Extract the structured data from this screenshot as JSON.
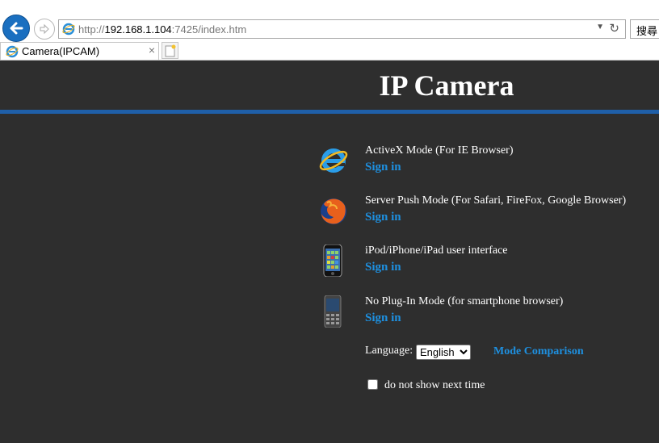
{
  "browser": {
    "url_prefix": "http://",
    "url_host": "192.168.1.104",
    "url_rest": ":7425/index.htm",
    "search_label": "搜尋",
    "tab_title": "Camera(IPCAM)",
    "tab_close": "×"
  },
  "page": {
    "title": "IP Camera",
    "modes": [
      {
        "description": "ActiveX Mode (For IE Browser)",
        "link": "Sign in",
        "icon": "ie-icon"
      },
      {
        "description": "Server Push Mode (For Safari, FireFox, Google Browser)",
        "link": "Sign in",
        "icon": "firefox-icon"
      },
      {
        "description": "iPod/iPhone/iPad user interface",
        "link": "Sign in",
        "icon": "iphone-icon"
      },
      {
        "description": "No Plug-In Mode (for smartphone browser)",
        "link": "Sign in",
        "icon": "smartphone-icon"
      }
    ],
    "language_label": "Language:",
    "language_selected": "English",
    "mode_comparison": "Mode Comparison",
    "dont_show_label": "do not show next time"
  },
  "colors": {
    "background": "#2e2e2e",
    "accent_bar": "#1f5fa8",
    "link": "#1e90e0"
  }
}
